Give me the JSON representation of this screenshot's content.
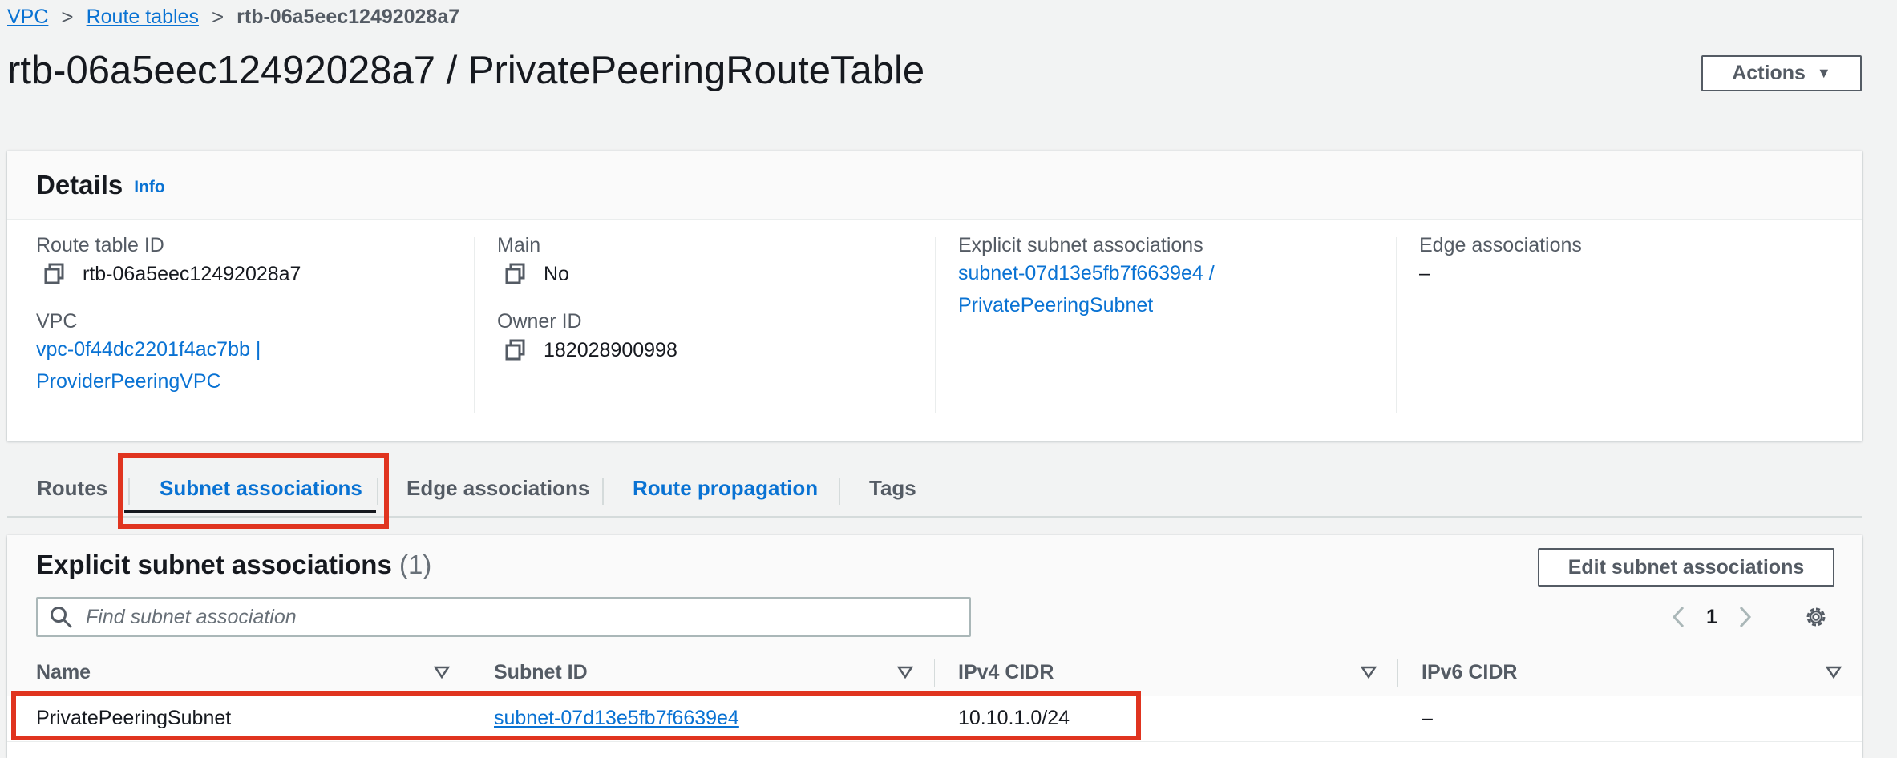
{
  "breadcrumb": {
    "items": [
      "VPC",
      "Route tables"
    ],
    "current": "rtb-06a5eec12492028a7"
  },
  "page": {
    "title": "rtb-06a5eec12492028a7 / PrivatePeeringRouteTable",
    "actions_label": "Actions"
  },
  "details": {
    "heading": "Details",
    "info_label": "Info",
    "route_table_id_label": "Route table ID",
    "route_table_id": "rtb-06a5eec12492028a7",
    "vpc_label": "VPC",
    "vpc_line1": "vpc-0f44dc2201f4ac7bb |",
    "vpc_line2": "ProviderPeeringVPC",
    "main_label": "Main",
    "main_value": "No",
    "owner_id_label": "Owner ID",
    "owner_id": "182028900998",
    "explicit_label": "Explicit subnet associations",
    "explicit_line1": "subnet-07d13e5fb7f6639e4 /",
    "explicit_line2": "PrivatePeeringSubnet",
    "edge_label": "Edge associations",
    "edge_value": "–"
  },
  "tabs": [
    {
      "label": "Routes",
      "active": false
    },
    {
      "label": "Subnet associations",
      "active": true
    },
    {
      "label": "Edge associations",
      "active": false
    },
    {
      "label": "Route propagation",
      "active": false,
      "link": true
    },
    {
      "label": "Tags",
      "active": false
    }
  ],
  "subnet_panel": {
    "title": "Explicit subnet associations",
    "count": "(1)",
    "edit_label": "Edit subnet associations",
    "search_placeholder": "Find subnet association",
    "page_number": "1",
    "columns": [
      "Name",
      "Subnet ID",
      "IPv4 CIDR",
      "IPv6 CIDR"
    ],
    "rows": [
      {
        "name": "PrivatePeeringSubnet",
        "subnet_id": "subnet-07d13e5fb7f6639e4",
        "ipv4": "10.10.1.0/24",
        "ipv6": "–"
      }
    ]
  },
  "colors": {
    "link": "#0972d3",
    "highlight": "#e0341f",
    "text": "#16191f",
    "muted": "#545b64"
  },
  "icons": [
    "chevron-right-icon",
    "caret-down-icon",
    "copy-icon",
    "search-icon",
    "chevron-left-icon",
    "settings-gear-icon",
    "sort-icon"
  ]
}
